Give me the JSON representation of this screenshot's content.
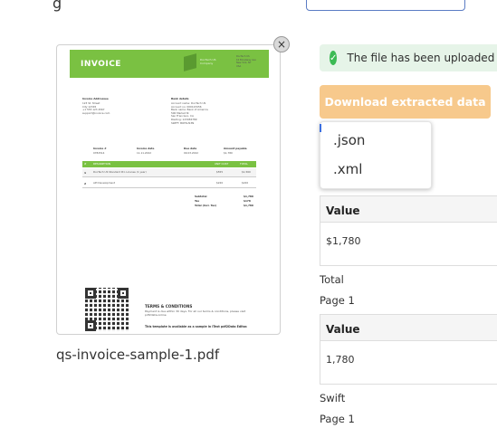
{
  "top": {
    "partial_text": "g"
  },
  "preview": {
    "close_label": "×",
    "file_name": "qs-invoice-sample-1.pdf",
    "invoice": {
      "header_title": "INVOICE",
      "brand_name": "DocTech US Company",
      "brand_address": "DocTech US\n10 Broadway Ave\nNew York, NY\nUSA",
      "bill_to_title": "Invoice Addressee",
      "bill_to": "123 St. Street\nCity 12345\n+1 555 123 4567\nsupport@invoice.com",
      "bank_title": "Bank details",
      "bank": "Account name: DocTech US\nAccount no: 000123456\nBank name: Bank of America\n500 Market St\nSan Francisco, CA\nRouting: 123456789\nSWIFT: BOFAUS3N",
      "meta_labels": [
        "Invoice #",
        "Invoice date",
        "Due date",
        "Amount payable"
      ],
      "meta_values": [
        "0782514",
        "11.11.2022",
        "09.03.2022",
        "$1,780"
      ],
      "table_head": [
        "#",
        "DESCRIPTION",
        "UNIT COST",
        "TOTAL"
      ],
      "rows": [
        {
          "num": "1",
          "desc": "DocTech US Standard Pro License (1 year)",
          "cost": "$555",
          "total": "$1,560"
        },
        {
          "num": "2",
          "desc": "API Development",
          "cost": "$220",
          "total": "$220"
        }
      ],
      "totals_labels": [
        "Subtotal",
        "Tax",
        "Total (Incl. Tax)"
      ],
      "totals_values": [
        "$1,780",
        "$178",
        "$1,780"
      ],
      "terms_title": "TERMS & CONDITIONS",
      "terms_text": "Payment is due within 30 days. For all our terms & conditions, please visit pdf2data.online",
      "terms_foot": "This template is available as a sample in iText pdf2Data Editor."
    }
  },
  "status": {
    "message": "The file has been uploaded and",
    "check_icon": "check-circle-icon"
  },
  "actions": {
    "download_label": "Download extracted data"
  },
  "dropdown": {
    "options": [
      ".json",
      ".xml"
    ]
  },
  "results": [
    {
      "header": "Value",
      "value": "$1,780"
    },
    {
      "label": "Total",
      "page": "Page 1",
      "header": "Value",
      "value": "1,780"
    },
    {
      "label": "Swift",
      "page": "Page 1"
    }
  ],
  "colors": {
    "invoice_green": "#7ac142",
    "success_bg": "#e6f4e8",
    "success_icon": "#3cba54",
    "download_btn": "#f7c98c",
    "input_border": "#5b7cc4"
  }
}
